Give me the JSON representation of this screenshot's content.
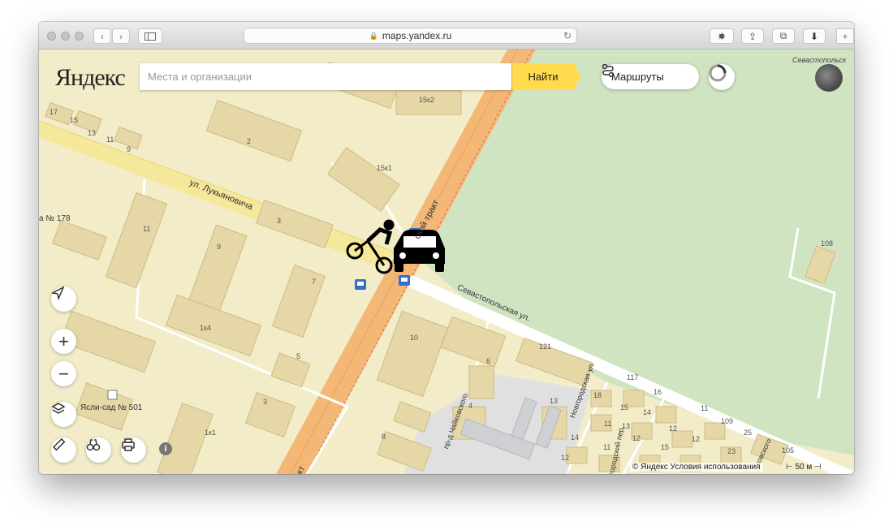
{
  "browser": {
    "url": "maps.yandex.ru",
    "new_tab_label": "+"
  },
  "header": {
    "logo": "Яндекс",
    "search_placeholder": "Места и организации",
    "find_button": "Найти",
    "routes_button": "Маршруты"
  },
  "map": {
    "streets": {
      "lukyanovicha": "ул. Лукьяновича",
      "trakt": "ский тракт",
      "trakt_bottom": "кт",
      "sevastopolskaya": "Севастопольская ул.",
      "chaykovskogo": "пр-д Чайковского",
      "novgorodskaya": "Новгородская ул.",
      "perp": "городский пер.",
      "chaykovskogo2": "ковского",
      "sevastopol_top": "Севастопольск"
    },
    "poi": {
      "kindergarten": "Ясли-сад № 501",
      "school": "а № 178"
    },
    "house_numbers": [
      "17",
      "15",
      "13",
      "11",
      "9",
      "2",
      "15к2",
      "15к1",
      "3",
      "11",
      "9",
      "7",
      "1к4",
      "5",
      "3",
      "1к1",
      "10",
      "6",
      "4",
      "8",
      "121",
      "13",
      "108",
      "117",
      "18",
      "16",
      "15",
      "11",
      "109",
      "25",
      "105",
      "14",
      "11",
      "13",
      "12",
      "12",
      "14",
      "12",
      "11",
      "12",
      "23",
      "15"
    ]
  },
  "footer": {
    "attribution": "© Яндекс Условия использования",
    "scale": "50 м"
  },
  "icons": [
    "locate-icon",
    "zoom-in-icon",
    "zoom-out-icon",
    "layers-icon",
    "ruler-icon",
    "panorama-icon",
    "print-icon",
    "info-icon",
    "bicycle-icon",
    "car-icon",
    "bus-stop-icon"
  ]
}
